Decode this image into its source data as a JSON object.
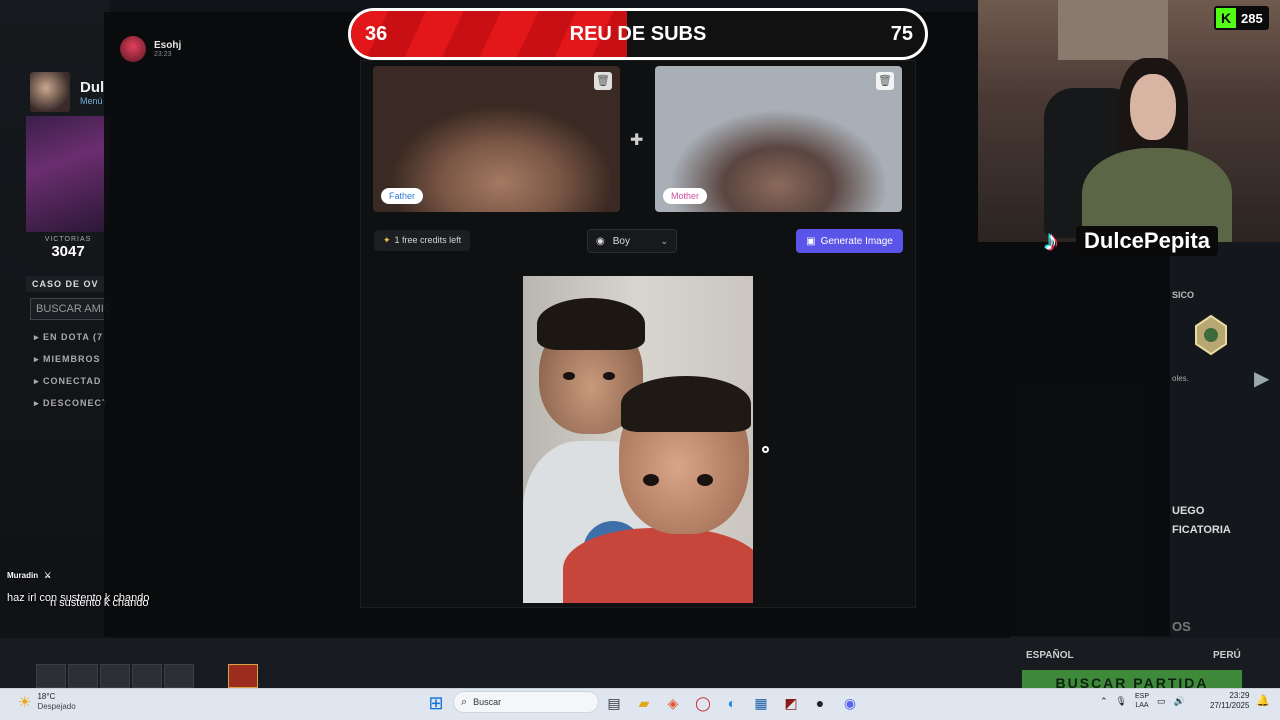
{
  "subgoal": {
    "current": "36",
    "title": "REU DE SUBS",
    "target": "75",
    "progress_fraction": 0.48
  },
  "kick": {
    "viewers": "285",
    "logo": "K"
  },
  "streamer": {
    "name": "DulcePepita"
  },
  "discord": {
    "user": "Esohj",
    "time": "23:23"
  },
  "game_client": {
    "profile_name": "Dul",
    "profile_menu": "Menú",
    "wins_label": "VICTORIAS",
    "wins_value": "3047",
    "case_label": "CASO DE OV",
    "search_placeholder": "BUSCAR AMIG",
    "friend_groups": [
      "EN DOTA (7",
      "MIEMBROS",
      "CONECTAD",
      "DESCONECT"
    ],
    "right_labels": {
      "clasico": "SICO",
      "rank_desc": "oles.",
      "juego": "UEGO",
      "ficatoria": "FICATORIA",
      "os": "OS"
    },
    "bottom_lang": "ESPAÑOL",
    "bottom_region": "PERÚ",
    "play_label": "BUSCAR PARTIDA"
  },
  "app": {
    "father_tag": "Father",
    "mother_tag": "Mother",
    "credits": "1 free credits left",
    "gender_value": "Boy",
    "generate_label": "Generate Image"
  },
  "chat": {
    "user": "Muradin",
    "message": "haz irl con sustento k chando",
    "echo": "n sustento k chando"
  },
  "taskbar": {
    "temp": "18°C",
    "weather": "Despejado",
    "search_placeholder": "Buscar",
    "lang_top": "ESP",
    "lang_bottom": "LAA",
    "time": "23:29",
    "date": "27/11/2025"
  },
  "colors": {
    "accent_red": "#e3161a",
    "generate_button": "#5b54e8",
    "kick_green": "#53fc18"
  }
}
